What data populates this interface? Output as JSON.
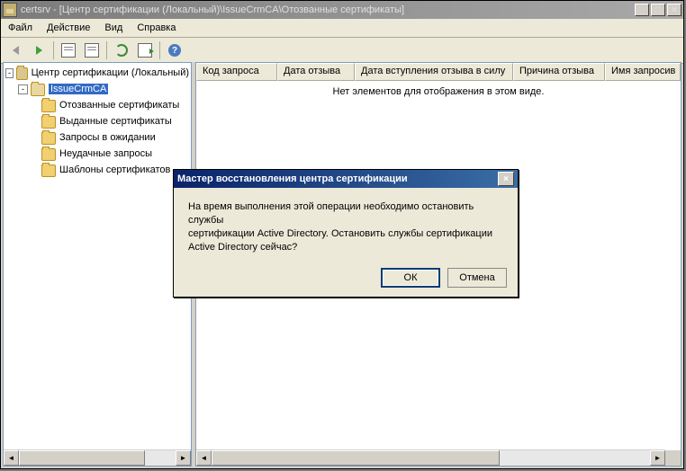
{
  "window": {
    "app": "certsrv",
    "title_sep": " - ",
    "path": "[Центр сертификации (Локальный)\\IssueCrmCA\\Отозванные сертификаты]"
  },
  "menubar": [
    "Файл",
    "Действие",
    "Вид",
    "Справка"
  ],
  "tree": {
    "root": "Центр сертификации (Локальный)",
    "ca": "IssueCrmCA",
    "items": [
      "Отозванные сертификаты",
      "Выданные сертификаты",
      "Запросы в ожидании",
      "Неудачные запросы",
      "Шаблоны сертификатов"
    ]
  },
  "listview": {
    "columns": [
      "Код запроса",
      "Дата отзыва",
      "Дата вступления отзыва в силу",
      "Причина отзыва",
      "Имя запросив"
    ],
    "empty_message": "Нет элементов для отображения в этом виде."
  },
  "dialog": {
    "title": "Мастер восстановления центра сертификации",
    "body_line1": "На время выполнения этой операции необходимо остановить службы",
    "body_line2": "сертификации Active Directory. Остановить службы сертификации",
    "body_line3": "Active Directory сейчас?",
    "ok": "ОК",
    "cancel": "Отмена"
  }
}
